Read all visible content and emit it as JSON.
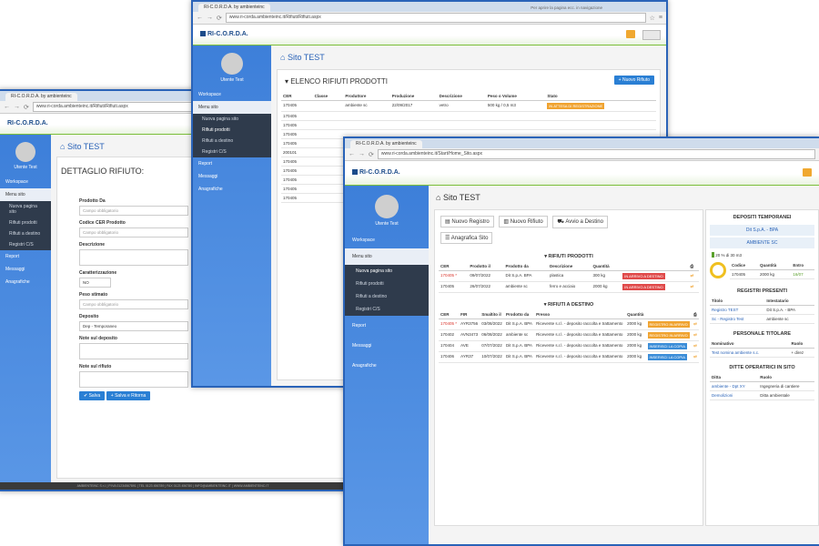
{
  "win1": {
    "tab": "RI-C.O.R.D.A. by ambienteinc",
    "url": "www.ri-corda.ambienteinc.it/Rifiuti/Rifiuti.aspx",
    "logo": "RI-C.O.R.D.A.",
    "user": "Utente Test",
    "sidebar": [
      "Workspace",
      "Menu sito",
      "Nuova pagina sito",
      "Rifiuti prodotti",
      "Rifiuti a destino",
      "Registri C/S",
      "Report",
      "Messaggi",
      "Anagrafiche"
    ],
    "page_title": "Sito TEST",
    "heading": "DETTAGLIO RIFIUTO:",
    "form": {
      "produttore_label": "Prodotto Da",
      "produttore_ph": "Campo obbligatorio",
      "cer_label": "Codice CER Prodotto",
      "cer_ph": "Campo obbligatorio",
      "descr_label": "Descrizione",
      "caratt_label": "Caratterizzazione",
      "caratt_value": "NO",
      "peso_label": "Peso stimato",
      "peso_ph": "Campo obbligatorio",
      "deposito_label": "Deposito",
      "deposito_value": "Dep - Temporaneo",
      "note_dep_label": "Note sul deposito",
      "note_rif_label": "Note sul rifiuto"
    },
    "save": "Salva",
    "save_back": "Salva e Ritorna",
    "footer": "AMBIENTEINC S.r.l. | P.IVA 01234567891 | TEL 0123 456789 | FAX 0123 456780 | INFO@AMBIENTEINC.IT | WWW.AMBIENTEINC.IT"
  },
  "win2": {
    "tab": "RI-C.O.R.D.A. by ambienteinc",
    "tab2": "Per aprire la pagina ecc. in navigazione",
    "url": "www.ri-corda.ambienteinc.it/Rifiuti/Rifiuti.aspx",
    "logo": "RI-C.O.R.D.A.",
    "user": "Utente Test",
    "sidebar": [
      "Workspace",
      "Menu sito",
      "Nuova pagina sito",
      "Rifiuti prodotti",
      "Rifiuti a destino",
      "Registri C/S",
      "Report",
      "Messaggi",
      "Anagrafiche"
    ],
    "page_title": "Sito TEST",
    "heading": "ELENCO RIFIUTI PRODOTTI",
    "new_btn": "+ Nuovo Rifiuto",
    "columns": [
      "CER",
      "Classe",
      "Produttore",
      "Produzione",
      "Descrizione",
      "Peso o Volume",
      "Stato"
    ],
    "rows": [
      [
        "170405",
        "",
        "ambiente sc",
        "22/09/2017",
        "vetro",
        "500 kg / 0,5 m3",
        "IN ATTESA DI REGISTRAZIONE"
      ],
      [
        "170405",
        "",
        "",
        "",
        "",
        "",
        ""
      ],
      [
        "170405",
        "",
        "",
        "",
        "",
        "",
        ""
      ],
      [
        "170405",
        "",
        "",
        "",
        "",
        "",
        ""
      ],
      [
        "170405",
        "",
        "",
        "",
        "",
        "",
        ""
      ],
      [
        "200101",
        "",
        "",
        "",
        "",
        "",
        ""
      ],
      [
        "170405",
        "",
        "",
        "",
        "",
        "",
        ""
      ],
      [
        "170405",
        "",
        "",
        "",
        "",
        "",
        ""
      ],
      [
        "170405",
        "",
        "",
        "",
        "",
        "",
        ""
      ],
      [
        "170405",
        "",
        "",
        "",
        "",
        "",
        ""
      ],
      [
        "170405",
        "",
        "",
        "",
        "",
        "",
        ""
      ]
    ]
  },
  "win3": {
    "tab": "RI-C.O.R.D.A. by ambienteinc",
    "url": "www.ri-corda.ambienteinc.it/Start/Home_Sito.aspx",
    "logo": "RI-C.O.R.D.A.",
    "user": "Utente Test",
    "sidebar": [
      "Workspace",
      "Menu sito",
      "Nuova pagina sito",
      "Rifiuti prodotti",
      "Rifiuti a destino",
      "Registri C/S",
      "Report",
      "Messaggi",
      "Anagrafiche"
    ],
    "page_title": "Sito TEST",
    "actions": [
      "Nuovo Registro",
      "Nuovo Rifiuto",
      "Avvio a Destino",
      "Anagrafica Sito"
    ],
    "prodotti_title": "RIFIUTI PRODOTTI",
    "prodotti_cols": [
      "CER",
      "Prodotto il",
      "Prodotto da",
      "Descrizione",
      "Quantità"
    ],
    "prodotti_rows": [
      {
        "cer": "170405 *",
        "data": "09/07/2022",
        "da": "Dit S.p.A. BPA",
        "descr": "plastica",
        "qta": "300 kg",
        "stato": "IN ARRIVO A DESTINO"
      },
      {
        "cer": "170405",
        "data": "26/07/2022",
        "da": "ambiente sc",
        "descr": "ferro e acciaio",
        "qta": "2000 kg",
        "stato": "IN ARRIVO A DESTINO"
      }
    ],
    "destino_title": "RIFIUTI A DESTINO",
    "destino_cols": [
      "CER",
      "FIR",
      "Smaltito il",
      "Prodotto da",
      "Presso",
      "Quantità"
    ],
    "destino_rows": [
      {
        "cer": "170405 *",
        "fir": "AYR3756",
        "data": "03/08/2022",
        "da": "Dit S.p.A. BPA",
        "presso": "Ricevente s.r.l. - deposito raccolta e trattamento",
        "qta": "2000 kg",
        "stato": "REGISTRO IN ARRIVO"
      },
      {
        "cer": "170402",
        "fir": "AVN3473",
        "data": "06/08/2022",
        "da": "ambiente sc",
        "presso": "Ricevente s.r.l. - deposito raccolta e trattamento",
        "qta": "2000 kg",
        "stato": "REGISTRO IN ARRIVO"
      },
      {
        "cer": "170404",
        "fir": "AVE",
        "data": "07/07/2022",
        "da": "Dit S.p.A. BPA",
        "presso": "Ricevente s.r.l. - deposito raccolta e trattamento",
        "qta": "2000 kg",
        "stato": "INSERISCI LA COPIA"
      },
      {
        "cer": "170406",
        "fir": "AYR37",
        "data": "10/07/2022",
        "da": "Dit S.p.A. BPA",
        "presso": "Ricevente s.r.l. - deposito raccolta e trattamento",
        "qta": "2000 kg",
        "stato": "INSERISCI LA COPIA"
      }
    ],
    "right": {
      "depositi_title": "DEPOSITI TEMPORANEI",
      "dep1": "Dit S.p.A. - BPA",
      "dep2": "AMBIENTE SC",
      "dep_tag": "20 % di 30 m3",
      "dep_cols": [
        "Codice",
        "Quantità",
        "Entro"
      ],
      "dep_row": [
        "170405",
        "2000 kg",
        "16/07"
      ],
      "registri_title": "REGISTRI PRESENTI",
      "registri_cols": [
        "Titolo",
        "Intestatario"
      ],
      "registri_rows": [
        [
          "Registro TEST",
          "Dit S.p.A. - BPA"
        ],
        [
          "Sc - Registro Test",
          "ambiente sc"
        ]
      ],
      "personale_title": "PERSONALE TITOLARE",
      "personale_cols": [
        "Nominativo",
        "Ruolo"
      ],
      "personale_rows": [
        [
          "Test nomina ambiente s.c.",
          "+ direz"
        ]
      ],
      "ditte_title": "DITTE OPERATRICI IN SITO",
      "ditte_cols": [
        "Ditta",
        "Ruolo"
      ],
      "ditte_rows": [
        [
          "ambiente - Dpt XY",
          "Ingegneria di cantiere"
        ],
        [
          "Demolizioni",
          "Ditta ambientale"
        ]
      ]
    }
  }
}
